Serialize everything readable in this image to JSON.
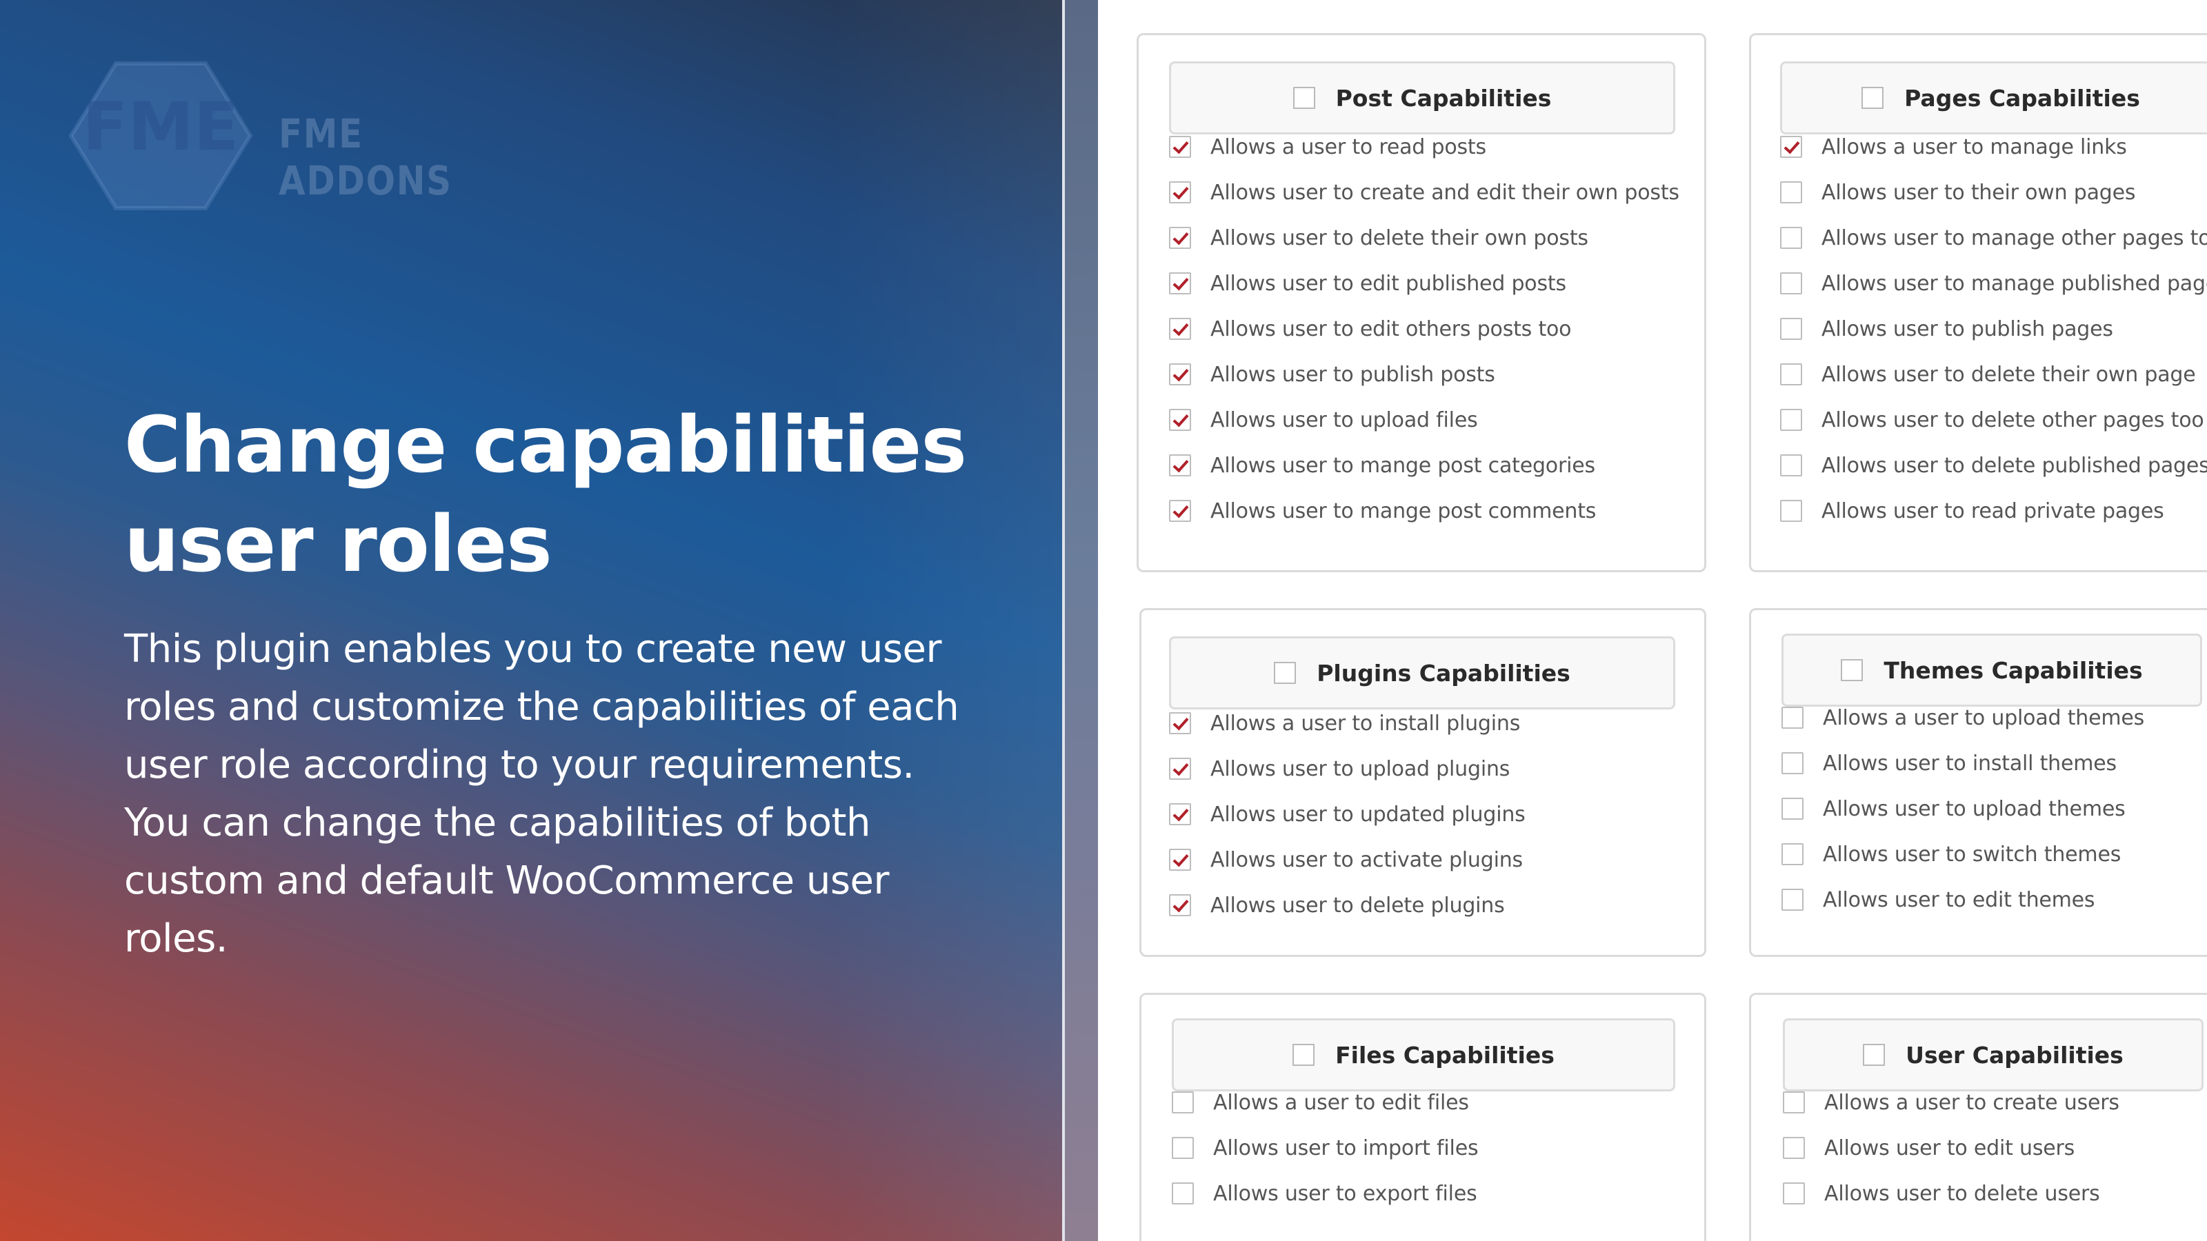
{
  "brand": {
    "logo_letters": "FME",
    "name": "FME ADDONS"
  },
  "hero": {
    "headline_line1": "Change capabilities",
    "headline_line2": "user roles",
    "description": "This plugin enables you to create new user roles and customize the capabilities of each user role according to your requirements. You can change the capabilities of both custom and default WooCommerce user roles."
  },
  "colors": {
    "check": "#b0202a"
  },
  "cards": {
    "post": {
      "title": "Post Capabilities",
      "items": [
        {
          "label": "Allows a user to read posts",
          "checked": true
        },
        {
          "label": "Allows user to create and edit their own posts",
          "checked": true
        },
        {
          "label": "Allows user to delete their own posts",
          "checked": true
        },
        {
          "label": "Allows user to edit published posts",
          "checked": true
        },
        {
          "label": "Allows user to edit others posts too",
          "checked": true
        },
        {
          "label": "Allows user to publish posts",
          "checked": true
        },
        {
          "label": "Allows user to upload files",
          "checked": true
        },
        {
          "label": "Allows user to mange post categories",
          "checked": true
        },
        {
          "label": "Allows user to mange post comments",
          "checked": true
        }
      ]
    },
    "pages": {
      "title": "Pages Capabilities",
      "items": [
        {
          "label": "Allows a user to manage links",
          "checked": true
        },
        {
          "label": "Allows user to their own pages",
          "checked": false
        },
        {
          "label": "Allows user to manage other pages too",
          "checked": false
        },
        {
          "label": "Allows user to manage published page",
          "checked": false
        },
        {
          "label": "Allows user to publish pages",
          "checked": false
        },
        {
          "label": "Allows user to delete their own page",
          "checked": false
        },
        {
          "label": "Allows user to delete other pages too",
          "checked": false
        },
        {
          "label": "Allows user to delete published pages",
          "checked": false
        },
        {
          "label": "Allows user to read private pages",
          "checked": false
        }
      ]
    },
    "plugins": {
      "title": "Plugins Capabilities",
      "items": [
        {
          "label": "Allows a user to install plugins",
          "checked": true
        },
        {
          "label": "Allows user to upload plugins",
          "checked": true
        },
        {
          "label": "Allows user to updated plugins",
          "checked": true
        },
        {
          "label": "Allows user to activate plugins",
          "checked": true
        },
        {
          "label": "Allows user to delete plugins",
          "checked": true
        }
      ]
    },
    "themes": {
      "title": "Themes Capabilities",
      "items": [
        {
          "label": "Allows a user to upload themes",
          "checked": false
        },
        {
          "label": "Allows user to install themes",
          "checked": false
        },
        {
          "label": "Allows user to upload themes",
          "checked": false
        },
        {
          "label": "Allows user to switch themes",
          "checked": false
        },
        {
          "label": "Allows user to edit themes",
          "checked": false
        }
      ]
    },
    "files": {
      "title": "Files Capabilities",
      "items": [
        {
          "label": "Allows a user to edit files",
          "checked": false
        },
        {
          "label": "Allows user to import files",
          "checked": false
        },
        {
          "label": "Allows user to export files",
          "checked": false
        }
      ]
    },
    "users": {
      "title": "User Capabilities",
      "items": [
        {
          "label": "Allows a user to create users",
          "checked": false
        },
        {
          "label": "Allows user to edit users",
          "checked": false
        },
        {
          "label": "Allows user to delete users",
          "checked": false
        }
      ]
    }
  }
}
